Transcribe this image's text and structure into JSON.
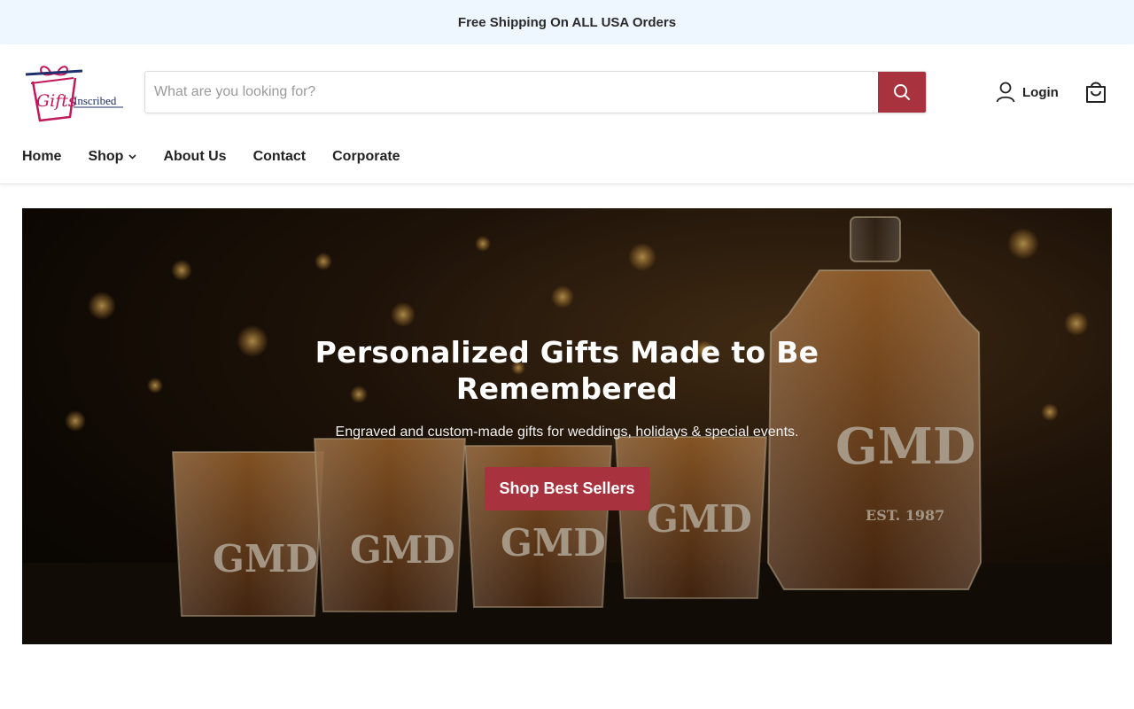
{
  "announcement": {
    "text": "Free Shipping On ALL USA Orders"
  },
  "header": {
    "logo": {
      "text_main": "Gifts",
      "text_secondary": "Inscribed"
    },
    "search": {
      "placeholder": "What are you looking for?",
      "value": ""
    },
    "login_label": "Login"
  },
  "nav": {
    "items": [
      {
        "label": "Home"
      },
      {
        "label": "Shop"
      },
      {
        "label": "About Us"
      },
      {
        "label": "Contact"
      },
      {
        "label": "Corporate"
      }
    ]
  },
  "hero": {
    "title": "Personalized Gifts Made to Be Remembered",
    "subtitle": "Engraved and custom-made gifts for weddings, holidays & special events.",
    "cta_label": "Shop Best Sellers",
    "engraving_monogram": "GMD",
    "engraving_est": "EST. 1987"
  },
  "colors": {
    "accent": "#a8323d",
    "announcement_bg": "#eef6ff",
    "logo_pink": "#c2185b",
    "logo_navy": "#1f2f6b"
  },
  "icons": {
    "search": "search-icon",
    "user": "user-icon",
    "cart": "shopping-bag-icon",
    "chevron": "chevron-down-icon"
  }
}
